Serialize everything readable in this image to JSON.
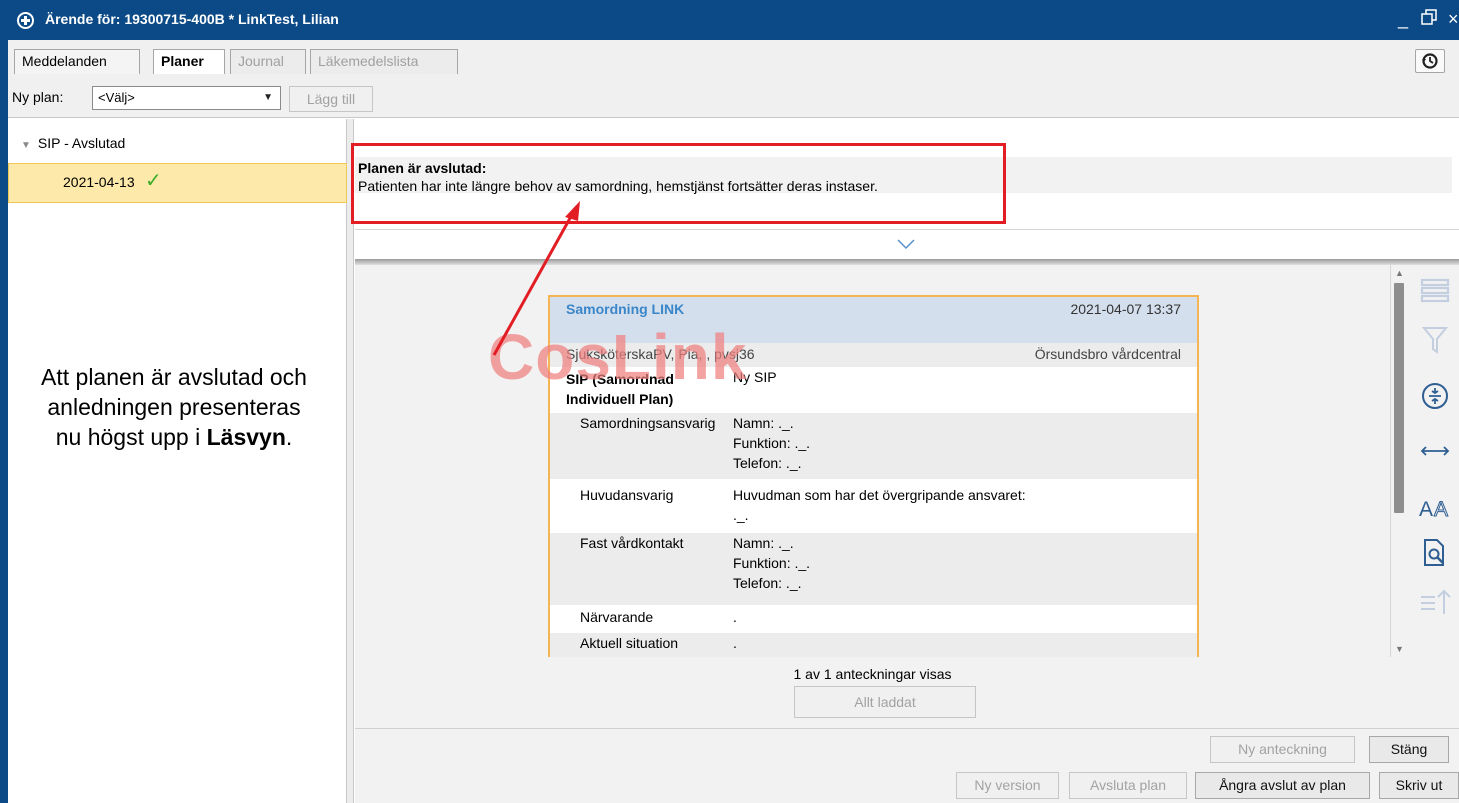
{
  "window": {
    "title": "Ärende för: 19300715-400B * LinkTest, Lilian"
  },
  "tabs": [
    {
      "label": "Meddelanden",
      "state": "normal"
    },
    {
      "label": "Planer",
      "state": "active"
    },
    {
      "label": "Journal",
      "state": "disabled"
    },
    {
      "label": "Läkemedelslista",
      "state": "disabled"
    }
  ],
  "toolbar": {
    "new_plan_label": "Ny plan:",
    "select_value": "<Välj>",
    "add_button": "Lägg till"
  },
  "tree": {
    "root_label": "SIP - Avslutad",
    "child_date": "2021-04-13",
    "check_glyph": "✓"
  },
  "annotation": {
    "text": "Att planen är avslutad och anledningen presenteras nu högst upp i ",
    "bold": "Läsvyn",
    "suffix": "."
  },
  "summary": {
    "title": "Planen är avslutad:",
    "text": "Patienten har inte längre behov av samordning, hemstjänst fortsätter deras instaser."
  },
  "watermark": "CosLink",
  "note": {
    "title": "Samordning LINK",
    "timestamp": "2021-04-07 13:37",
    "author": "SjuksköterskaPV, Pia, , pvsj36",
    "org": "Örsundsbro vårdcentral",
    "sip_label": "SIP (Samordnad Individuell Plan)",
    "sip_value": "Ny SIP",
    "rows": [
      {
        "key": "Samordningsansvarig",
        "lines": [
          "Namn:   ._.",
          "Funktion: ._.",
          "Telefon:  ._."
        ]
      },
      {
        "key": "Huvudansvarig",
        "lines": [
          "Huvudman som har det övergripande ansvaret:",
          "._."
        ]
      },
      {
        "key": "Fast vårdkontakt",
        "lines": [
          "Namn:   ._.",
          "Funktion: ._.",
          "Telefon:  ._."
        ]
      },
      {
        "key": "Närvarande",
        "lines": [
          "."
        ]
      },
      {
        "key": "Aktuell situation",
        "lines": [
          "."
        ]
      }
    ]
  },
  "notes_count": "1 av 1 anteckningar visas",
  "load_button": "Allt laddat",
  "buttons": {
    "new_note": "Ny anteckning",
    "close": "Stäng",
    "new_version": "Ny version",
    "end_plan": "Avsluta plan",
    "undo_end": "Ångra avslut av plan",
    "print": "Skriv ut"
  },
  "colors": {
    "titlebar": "#0b4a86",
    "highlight_box": "#e21d24",
    "card_border": "#f5b555",
    "note_title": "#3a86c8",
    "check": "#3dae2b",
    "selected_row": "#fde9a9"
  }
}
